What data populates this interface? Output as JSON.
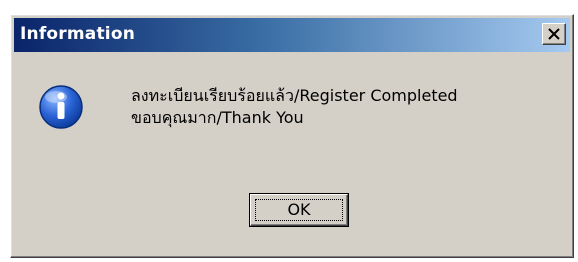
{
  "window": {
    "title": "Information"
  },
  "icons": {
    "title_close": "close-icon",
    "message_icon": "information-icon"
  },
  "message": {
    "line1": "ลงทะเบียนเรียบร้อยแล้ว/Register Completed",
    "line2": "ขอบคุณมาก/Thank You"
  },
  "buttons": {
    "ok_label": "OK"
  },
  "colors": {
    "titlebar_start": "#0a246a",
    "titlebar_end": "#a6caf0",
    "dialog_face": "#d4d0c8",
    "icon_blue": "#1f5bc6"
  }
}
